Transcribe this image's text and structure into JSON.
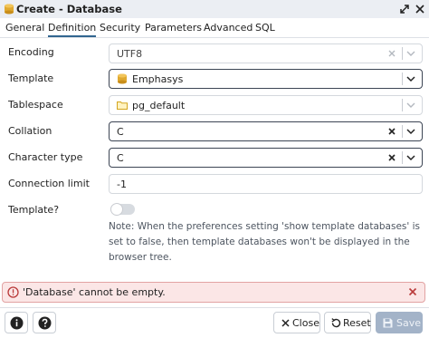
{
  "window": {
    "title": "Create - Database"
  },
  "tabs": [
    "General",
    "Definition",
    "Security",
    "Parameters",
    "Advanced",
    "SQL"
  ],
  "active_tab": "Definition",
  "form": {
    "encoding": {
      "label": "Encoding",
      "value": "UTF8"
    },
    "template": {
      "label": "Template",
      "value": "Emphasys"
    },
    "tablespace": {
      "label": "Tablespace",
      "value": "pg_default"
    },
    "collation": {
      "label": "Collation",
      "value": "C"
    },
    "character_type": {
      "label": "Character type",
      "value": "C"
    },
    "connection_limit": {
      "label": "Connection limit",
      "value": "-1"
    },
    "is_template": {
      "label": "Template?",
      "value": false
    }
  },
  "note": "Note: When the preferences setting 'show template databases' is set to false, then template databases won't be displayed in the browser tree.",
  "error": {
    "message": "'Database' cannot be empty."
  },
  "footer": {
    "close_label": "Close",
    "reset_label": "Reset",
    "save_label": "Save"
  },
  "colors": {
    "accent": "#326690",
    "error_bg": "#fbe6e6",
    "error_border": "#e2a3a3",
    "save_disabled": "#a3b3c8"
  }
}
